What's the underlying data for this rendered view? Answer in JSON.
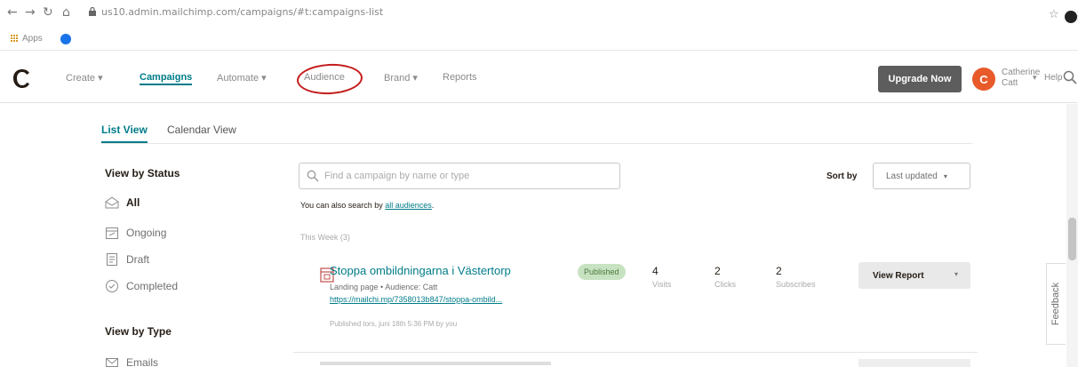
{
  "browser": {
    "url": "us10.admin.mailchimp.com/campaigns/#t:campaigns-list",
    "bookmarks": {
      "apps_label": "Apps"
    }
  },
  "header": {
    "nav": [
      "Create",
      "Campaigns",
      "Automate",
      "Audience",
      "Brand",
      "Reports"
    ],
    "upgrade_label": "Upgrade Now",
    "avatar_initial": "C",
    "user_first": "Catherine",
    "user_last": "Catt",
    "help_label": "Help"
  },
  "view_tabs": {
    "list": "List View",
    "calendar": "Calendar View"
  },
  "sidebar": {
    "status_heading": "View by Status",
    "status_items": [
      "All",
      "Ongoing",
      "Draft",
      "Completed"
    ],
    "type_heading": "View by Type",
    "type_items": [
      "Emails"
    ]
  },
  "search": {
    "placeholder": "Find a campaign by name or type",
    "also_prefix": "You can also search by ",
    "also_link": "all audiences",
    "also_suffix": "."
  },
  "sort": {
    "label": "Sort by",
    "value": "Last updated"
  },
  "group_label": "This Week (3)",
  "campaign": {
    "title": "Stoppa ombildningarna i Västertorp",
    "subtitle": "Landing page • Audience: Catt",
    "link": "https://mailchi.mp/7358013b847/stoppa-ombild...",
    "published": "Published tors, juni 18th 5:36 PM by you",
    "status": "Published",
    "stats": [
      {
        "value": "4",
        "label": "Visits"
      },
      {
        "value": "2",
        "label": "Clicks"
      },
      {
        "value": "2",
        "label": "Subscribes"
      }
    ],
    "action": "View Report"
  },
  "feedback_label": "Feedback",
  "colors": {
    "accent": "#007c89",
    "upgrade": "#5d5d5d",
    "avatar": "#e85a2a",
    "badge_bg": "#c7e2c1",
    "annotation": "#c41c1c"
  }
}
